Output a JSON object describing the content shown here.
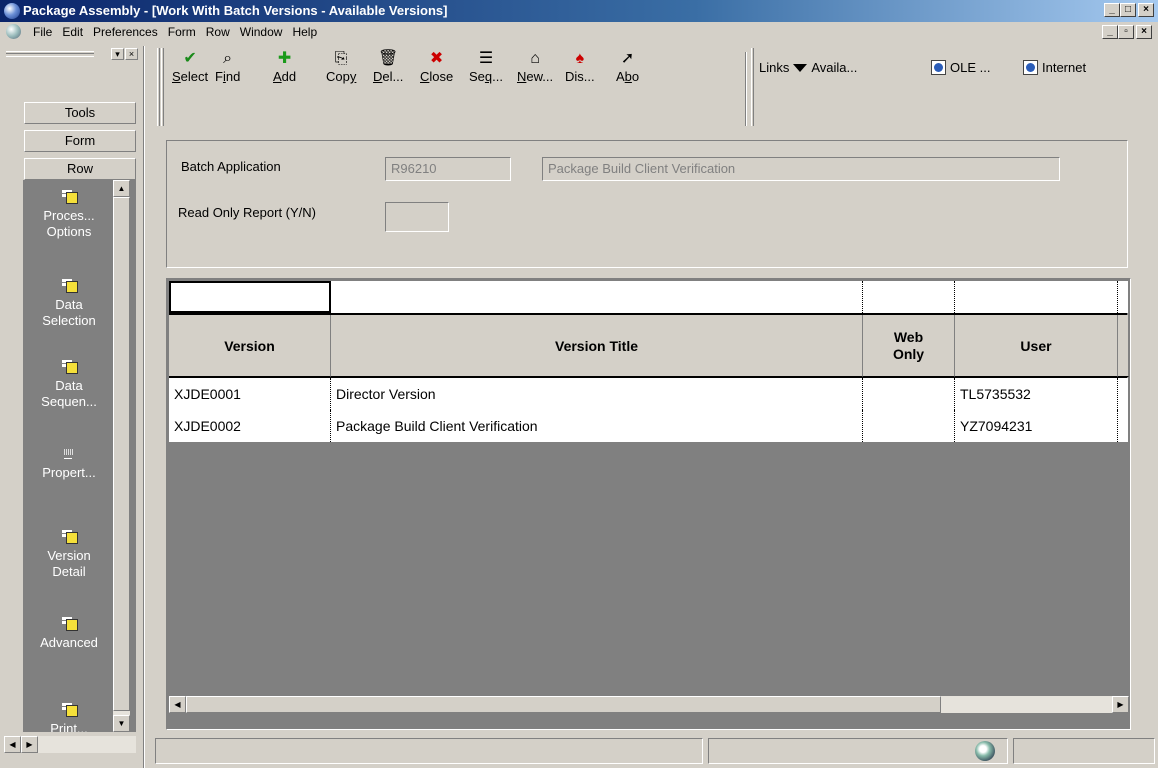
{
  "window": {
    "title": "Package Assembly - [Work With Batch Versions - Available Versions]",
    "min_glyph": "_",
    "max_glyph": "□",
    "close_glyph": "×",
    "restore_glyph": "▫"
  },
  "menubar": {
    "items": [
      "File",
      "Edit",
      "Preferences",
      "Form",
      "Row",
      "Window",
      "Help"
    ]
  },
  "leftpanel": {
    "buttons": [
      "Tools",
      "Form",
      "Row"
    ],
    "items": [
      {
        "label": "Proces...\nOptions",
        "icon": "exit-doc-icon"
      },
      {
        "label": "Data\nSelection",
        "icon": "exit-doc-icon"
      },
      {
        "label": "Data\nSequen...",
        "icon": "exit-doc-icon"
      },
      {
        "label": "Propert...",
        "icon": "properties-icon"
      },
      {
        "label": "Version\nDetail",
        "icon": "exit-doc-icon"
      },
      {
        "label": "Advanced",
        "icon": "exit-doc-icon"
      },
      {
        "label": "Print...",
        "icon": "exit-doc-icon"
      }
    ],
    "up_glyph": "▲",
    "down_glyph": "▼",
    "left_glyph": "◀",
    "right_glyph": "▶"
  },
  "toolbar": {
    "buttons": [
      {
        "label": "Select",
        "u": "S",
        "rest": "elect",
        "icon": "checkmark-icon",
        "glyph": "✔",
        "color": "#1a8a1a"
      },
      {
        "label": "Find",
        "pre": "F",
        "u": "i",
        "rest": "nd",
        "icon": "find-icon",
        "glyph": "⌕",
        "color": "#000"
      },
      {
        "label": "Add",
        "u": "A",
        "rest": "dd",
        "icon": "add-icon",
        "glyph": "✚",
        "color": "#1a9a1a"
      },
      {
        "label": "Copy",
        "pre": "Cop",
        "u": "y",
        "rest": "",
        "icon": "copy-icon",
        "glyph": "⎘",
        "color": "#000"
      },
      {
        "label": "Del...",
        "u": "D",
        "rest": "el...",
        "icon": "delete-icon",
        "glyph": "🗑",
        "color": "#000"
      },
      {
        "label": "Close",
        "u": "C",
        "rest": "lose",
        "icon": "close-icon",
        "glyph": "✖",
        "color": "#cc0000"
      },
      {
        "label": "Seq...",
        "pre": "Se",
        "u": "q",
        "rest": "...",
        "icon": "sequence-icon",
        "glyph": "☰",
        "color": "#000"
      },
      {
        "label": "New...",
        "u": "N",
        "rest": "ew...",
        "icon": "new-icon",
        "glyph": "⌂",
        "color": "#000"
      },
      {
        "label": "Dis...",
        "pre": "Dis",
        "u": "",
        "rest": "...",
        "icon": "display-icon",
        "glyph": "♠",
        "color": "#000"
      },
      {
        "label": "Abo",
        "pre": "A",
        "u": "b",
        "rest": "o",
        "icon": "about-icon",
        "glyph": "➚",
        "color": "#000"
      }
    ],
    "links_label": "Links",
    "available_label": "Availa...",
    "ole_label": "OLE ...",
    "internet_label": "Internet"
  },
  "header": {
    "batch_application_label": "Batch Application",
    "batch_application_value": "R96210",
    "batch_application_desc": "Package Build Client Verification",
    "read_only_label": "Read Only Report (Y/N)",
    "read_only_value": ""
  },
  "grid": {
    "columns": [
      "Version",
      "Version Title",
      "Web\nOnly",
      "User"
    ],
    "rows": [
      {
        "version": "XJDE0001",
        "title": "Director Version",
        "web_only": "",
        "user": "TL5735532"
      },
      {
        "version": "XJDE0002",
        "title": "Package Build Client Verification",
        "web_only": "",
        "user": "YZ7094231"
      }
    ],
    "left_glyph": "◀",
    "right_glyph": "▶"
  }
}
